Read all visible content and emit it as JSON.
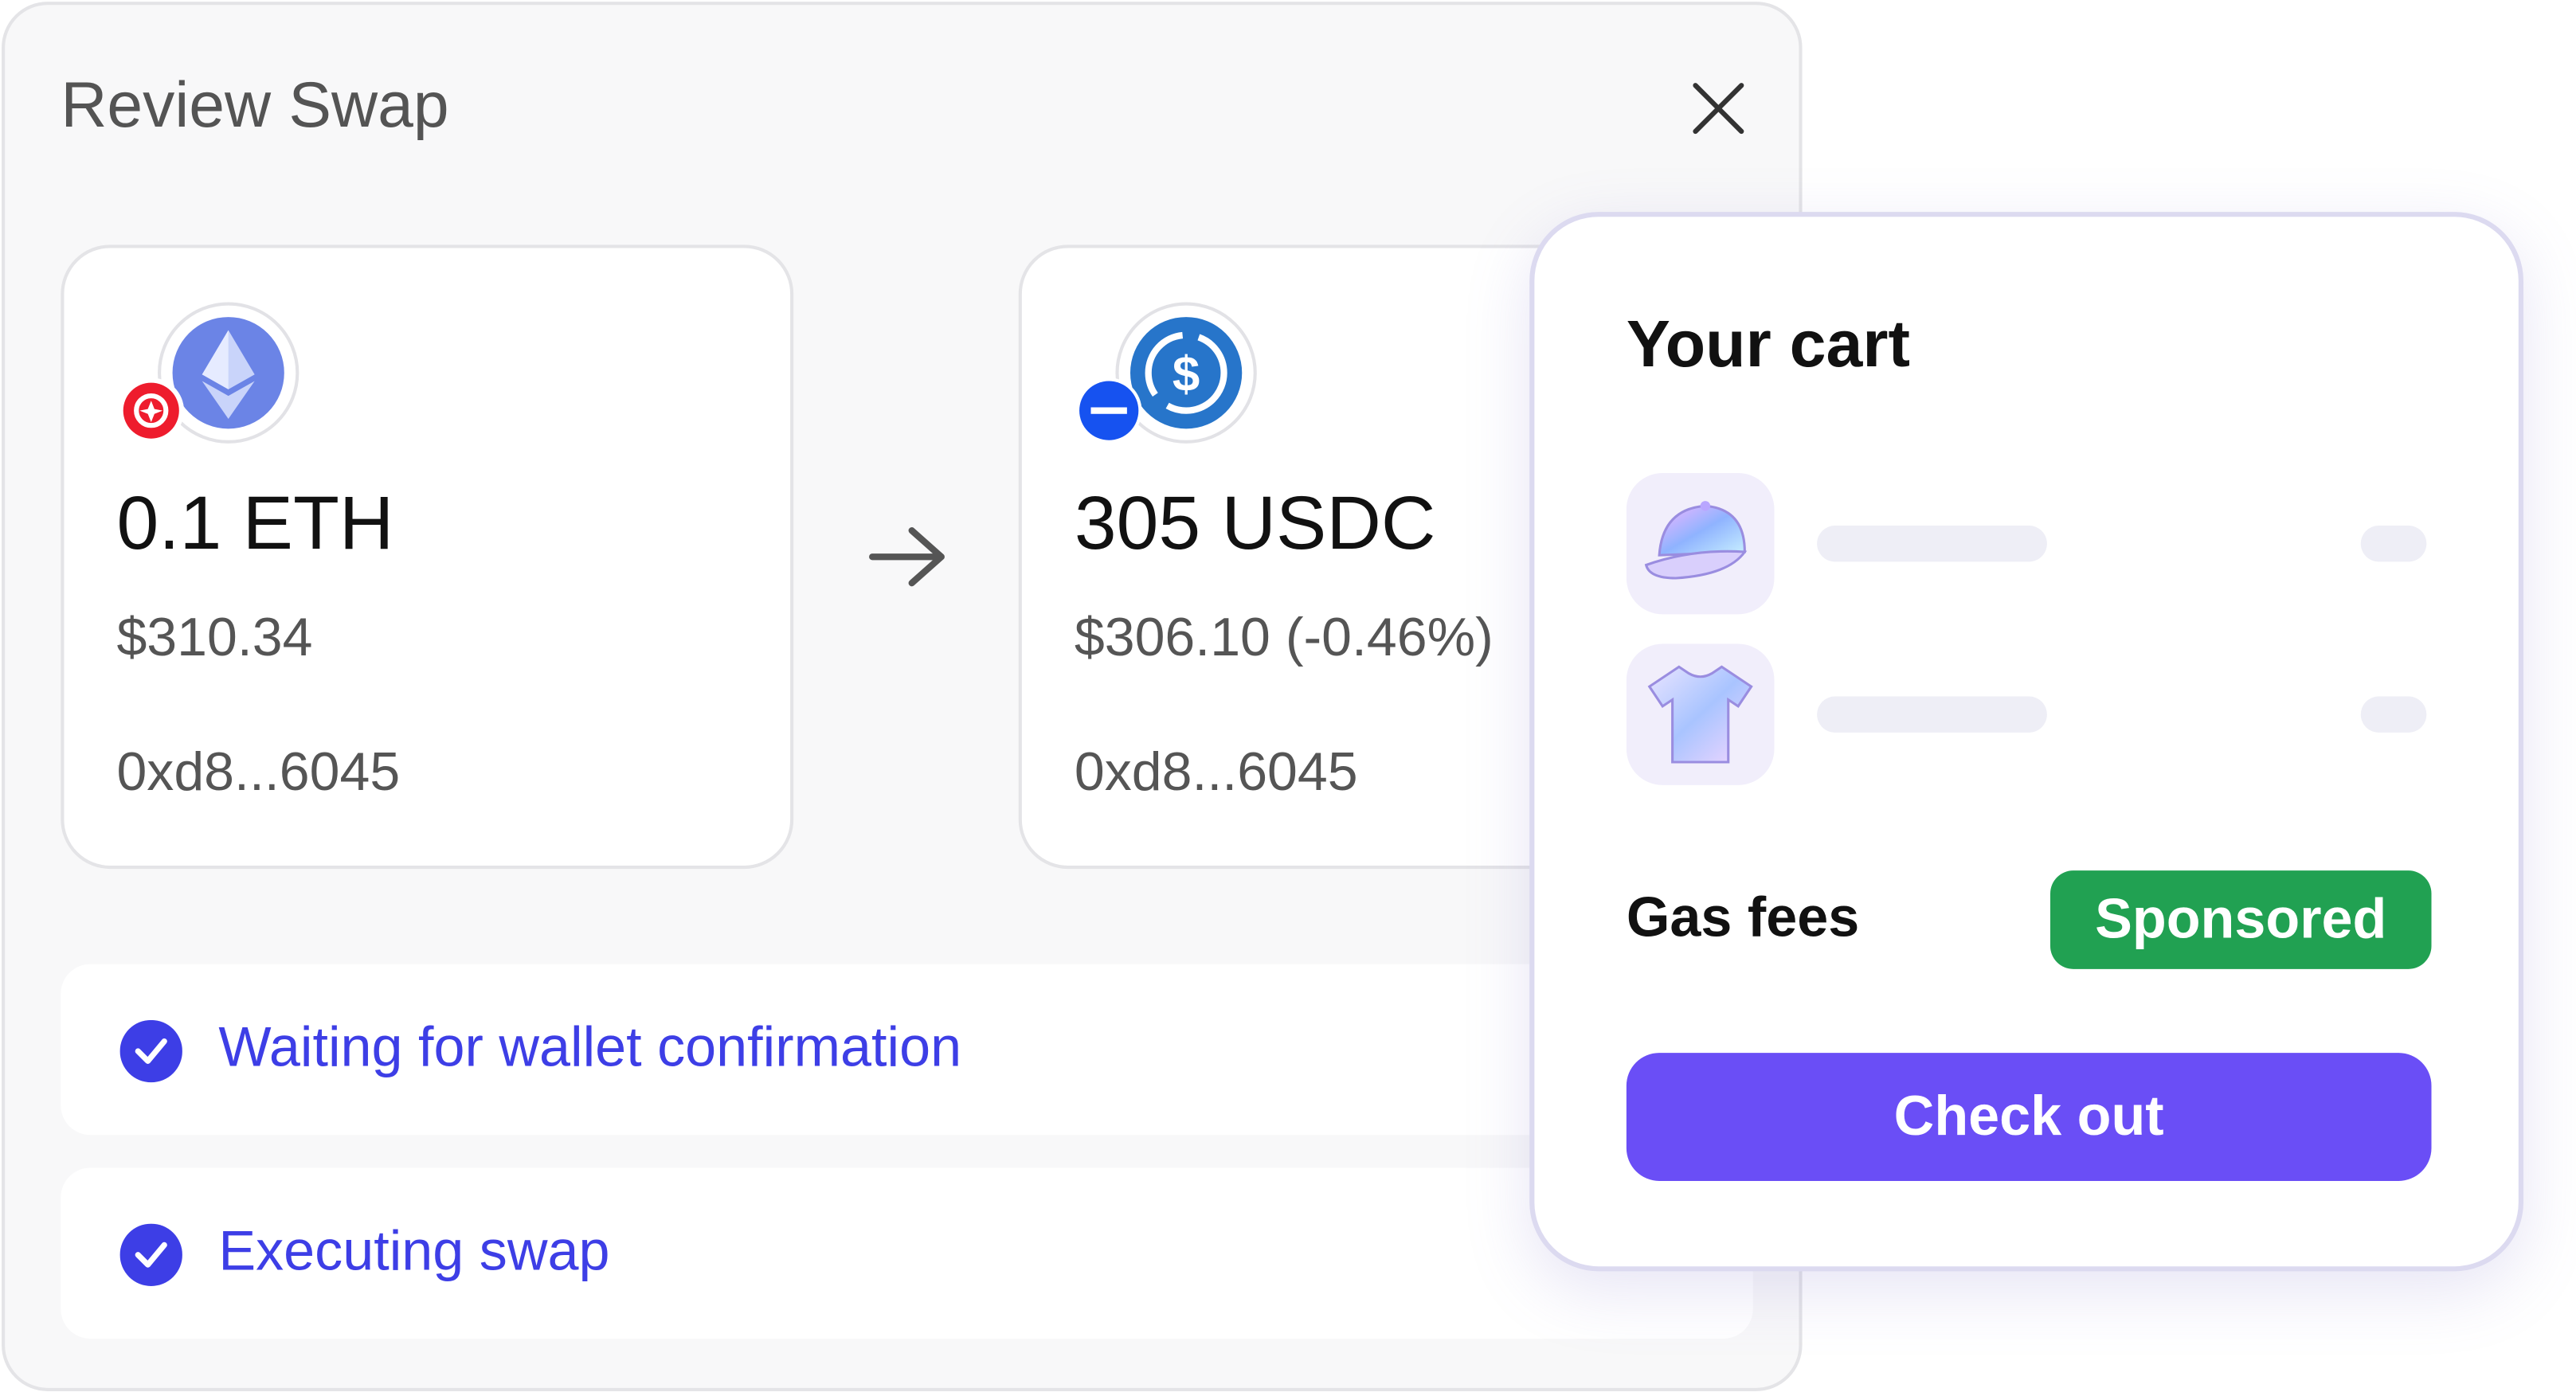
{
  "swap": {
    "title": "Review Swap",
    "from": {
      "amount": "0.1 ETH",
      "usd_value": "$310.34",
      "address": "0xd8...6045",
      "token_icon": "ethereum-icon",
      "chain_icon": "optimism-icon"
    },
    "to": {
      "amount": "305 USDC",
      "usd_value": "$306.10 (-0.46%)",
      "address": "0xd8...6045",
      "token_icon": "usdc-icon",
      "chain_icon": "base-icon"
    },
    "steps": [
      {
        "label": "Waiting for wallet confirmation",
        "icon": "check-circle-icon"
      },
      {
        "label": "Executing swap",
        "icon": "check-circle-icon"
      }
    ]
  },
  "cart": {
    "title": "Your cart",
    "items": [
      {
        "icon": "cap-icon"
      },
      {
        "icon": "tshirt-icon"
      }
    ],
    "gas_label": "Gas fees",
    "gas_value": "Sponsored",
    "checkout_label": "Check out"
  },
  "colors": {
    "accent": "#3d3ee6",
    "checkout": "#6a4ef6",
    "sponsored": "#21a152"
  }
}
